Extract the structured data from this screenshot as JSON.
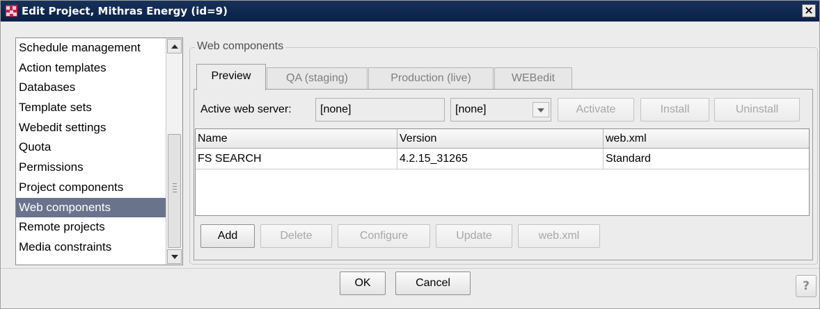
{
  "window": {
    "title": "Edit Project, Mithras Energy (id=9)",
    "close_label": "×",
    "accent": "#0a2148",
    "icon": "project-icon"
  },
  "nav": {
    "items": [
      {
        "label": "Schedule management",
        "selected": false
      },
      {
        "label": "Action templates",
        "selected": false
      },
      {
        "label": "Databases",
        "selected": false
      },
      {
        "label": "Template sets",
        "selected": false
      },
      {
        "label": "Webedit settings",
        "selected": false
      },
      {
        "label": "Quota",
        "selected": false
      },
      {
        "label": "Permissions",
        "selected": false
      },
      {
        "label": "Project components",
        "selected": false
      },
      {
        "label": "Web components",
        "selected": true
      },
      {
        "label": "Remote projects",
        "selected": false
      },
      {
        "label": "Media constraints",
        "selected": false
      }
    ],
    "selected_color": "#6a738c"
  },
  "web_components": {
    "group_title": "Web components",
    "tabs": [
      {
        "label": "Preview",
        "active": true
      },
      {
        "label": "QA (staging)",
        "active": false
      },
      {
        "label": "Production (live)",
        "active": false
      },
      {
        "label": "WEBedit",
        "active": false
      }
    ],
    "server": {
      "label": "Active web server:",
      "value": "[none]",
      "combo_value": "[none]",
      "activate_label": "Activate",
      "install_label": "Install",
      "uninstall_label": "Uninstall"
    },
    "table": {
      "columns": [
        "Name",
        "Version",
        "web.xml"
      ],
      "rows": [
        [
          "FS SEARCH",
          "4.2.15_31265",
          "Standard"
        ]
      ]
    },
    "actions": {
      "add_label": "Add",
      "delete_label": "Delete",
      "configure_label": "Configure",
      "update_label": "Update",
      "webxml_label": "web.xml"
    }
  },
  "footer": {
    "ok_label": "OK",
    "cancel_label": "Cancel",
    "help_label": "?"
  }
}
